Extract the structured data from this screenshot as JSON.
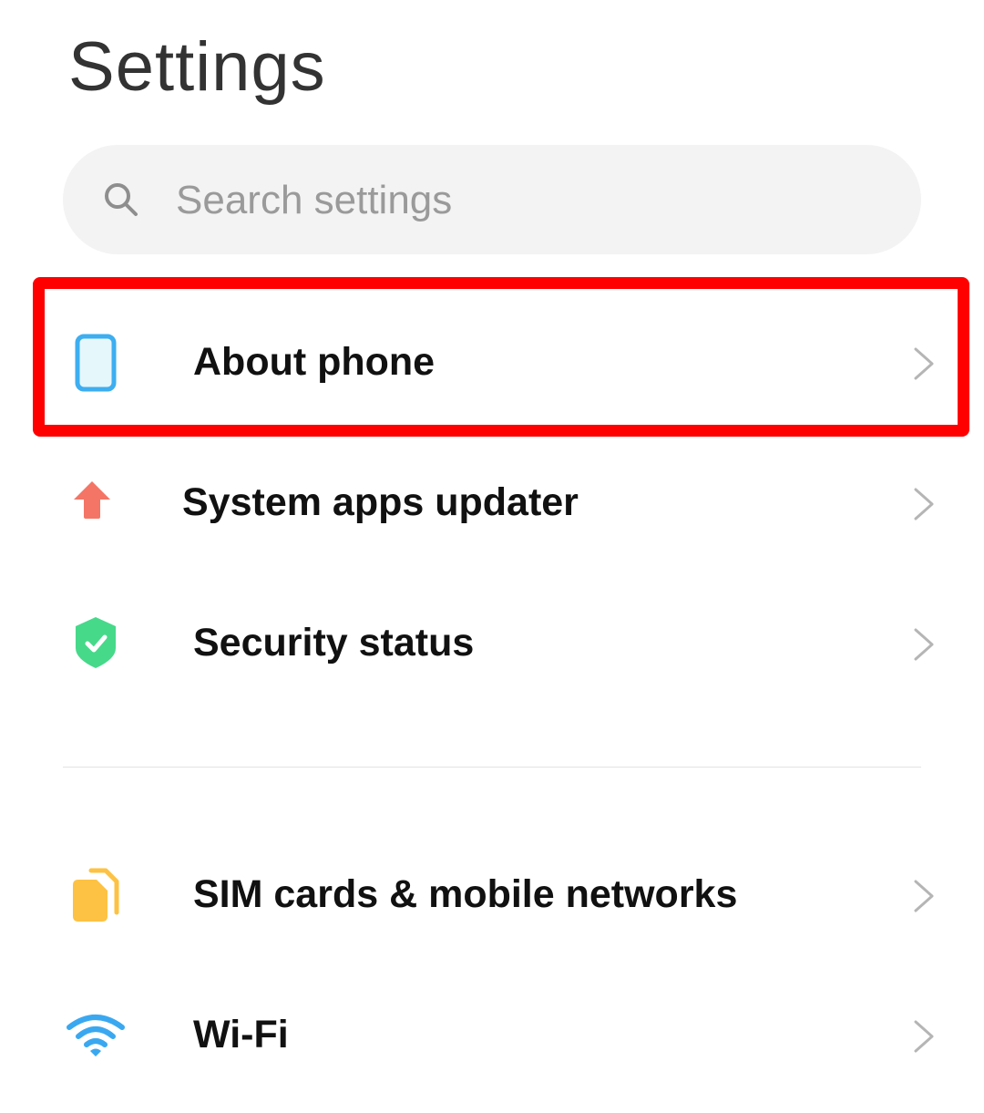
{
  "header": {
    "title": "Settings"
  },
  "search": {
    "placeholder": "Search settings",
    "icon": "search-icon"
  },
  "highlight": {
    "target": "About phone",
    "color": "#ff0000"
  },
  "groups": [
    {
      "items": [
        {
          "label": "About phone",
          "icon": "phone-icon",
          "icon_color": "#3daef0"
        },
        {
          "label": "System apps updater",
          "icon": "arrow-up-icon",
          "icon_color": "#f47566"
        },
        {
          "label": "Security status",
          "icon": "shield-check-icon",
          "icon_color": "#46d98a"
        }
      ]
    },
    {
      "items": [
        {
          "label": "SIM cards & mobile networks",
          "icon": "sim-cards-icon",
          "icon_color": "#fdc243"
        },
        {
          "label": "Wi-Fi",
          "icon": "wifi-icon",
          "icon_color": "#3aa8f0"
        }
      ]
    }
  ]
}
